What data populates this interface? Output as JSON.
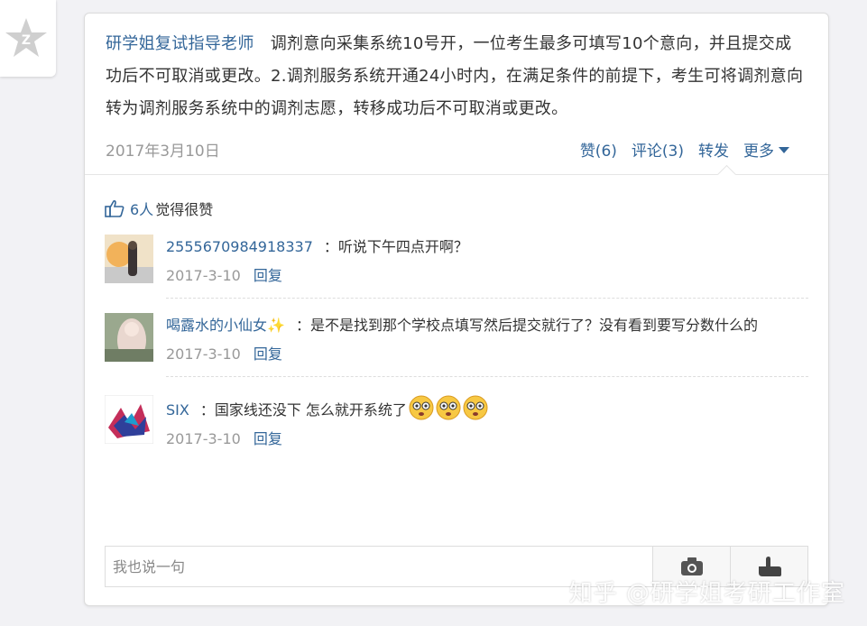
{
  "post": {
    "author": "研学姐复试指导老师",
    "text": "调剂意向采集系统10号开，一位考生最多可填写10个意向，并且提交成功后不可取消或更改。2.调剂服务系统开通24小时内，在满足条件的前提下，考生可将调剂意向转为调剂服务系统中的调剂志愿，转移成功后不可取消或更改。",
    "date": "2017年3月10日",
    "actions": {
      "like": "赞(6)",
      "comment": "评论(3)",
      "repost": "转发",
      "more": "更多"
    }
  },
  "likes": {
    "count": "6人",
    "suffix": "觉得很赞"
  },
  "comments": [
    {
      "user": "2555670984918337",
      "text": "：听说下午四点开啊？",
      "date": "2017-3-10",
      "reply": "回复"
    },
    {
      "user": "喝露水的小仙女✨",
      "text": "：是不是找到那个学校点填写然后提交就行了？没有看到要写分数什么的",
      "date": "2017-3-10",
      "reply": "回复"
    },
    {
      "user": "SIX",
      "text": "：国家线还没下 怎么就开系统了",
      "date": "2017-3-10",
      "reply": "回复"
    }
  ],
  "input": {
    "placeholder": "我也说一句"
  },
  "watermark": "知乎 @研学姐考研工作室",
  "colors": {
    "link": "#336699",
    "muted": "#999999"
  }
}
